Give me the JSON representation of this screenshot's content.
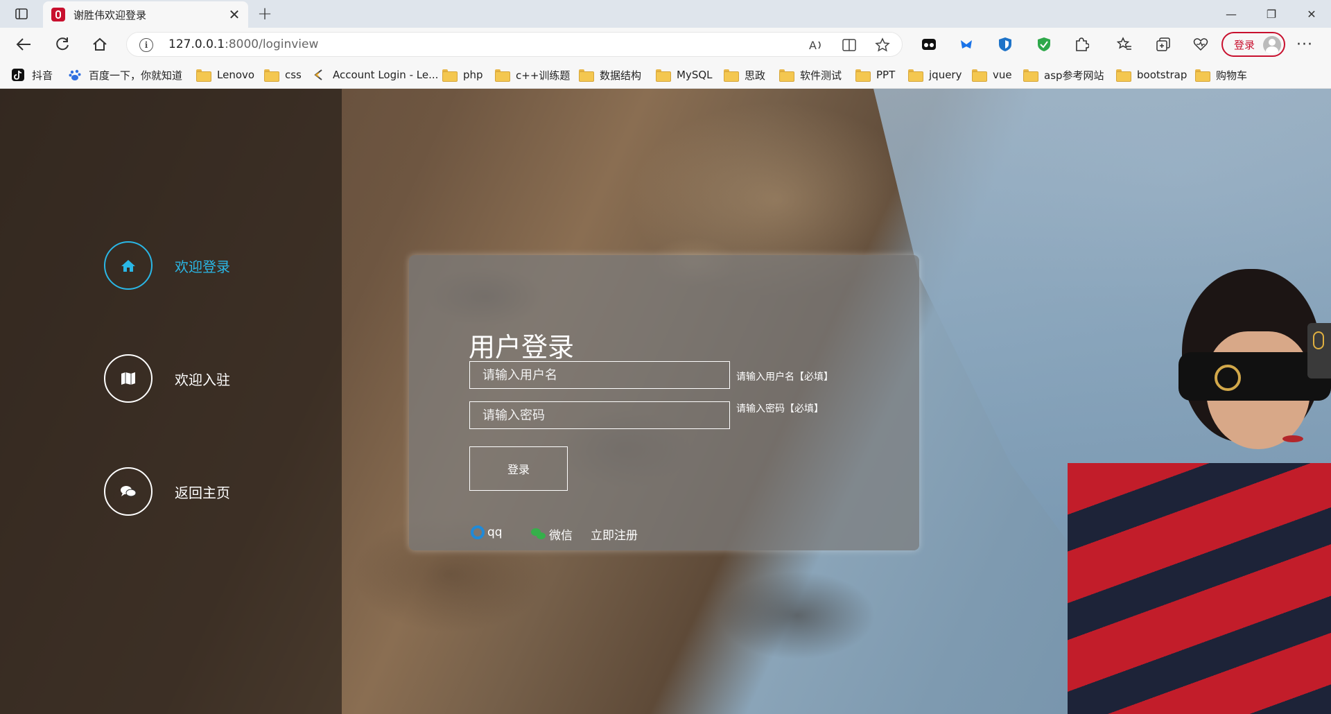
{
  "browser": {
    "tab_title": "谢胜伟欢迎登录",
    "tab_close": "✕",
    "new_tab": "+",
    "address": {
      "host": "127.0.0.1",
      "path": ":8000/loginview"
    },
    "profile_button": "登录",
    "more": "···",
    "window_controls": {
      "minimize": "—",
      "restore": "❐",
      "close": "✕"
    }
  },
  "bookmarks": [
    {
      "label": "抖音",
      "icon": "douyin-icon"
    },
    {
      "label": "百度一下，你就知道",
      "icon": "baidu-icon"
    },
    {
      "label": "Lenovo",
      "icon": "folder-icon"
    },
    {
      "label": "css",
      "icon": "folder-icon"
    },
    {
      "label": "Account Login - Le...",
      "icon": "lenovo-login-icon"
    },
    {
      "label": "php",
      "icon": "folder-icon"
    },
    {
      "label": "c++训练题",
      "icon": "folder-icon"
    },
    {
      "label": "数据结构",
      "icon": "folder-icon"
    },
    {
      "label": "MySQL",
      "icon": "folder-icon"
    },
    {
      "label": "思政",
      "icon": "folder-icon"
    },
    {
      "label": "软件测试",
      "icon": "folder-icon"
    },
    {
      "label": "PPT",
      "icon": "folder-icon"
    },
    {
      "label": "jquery",
      "icon": "folder-icon"
    },
    {
      "label": "vue",
      "icon": "folder-icon"
    },
    {
      "label": "asp参考网站",
      "icon": "folder-icon"
    },
    {
      "label": "bootstrap",
      "icon": "folder-icon"
    },
    {
      "label": "购物车",
      "icon": "folder-icon"
    }
  ],
  "sidebar": {
    "items": [
      {
        "label": "欢迎登录",
        "icon": "home-icon",
        "active": true
      },
      {
        "label": "欢迎入驻",
        "icon": "map-icon",
        "active": false
      },
      {
        "label": "返回主页",
        "icon": "chat-icon",
        "active": false
      }
    ]
  },
  "login": {
    "title": "用户登录",
    "username_placeholder": "请输入用户名",
    "username_hint": "请输入用户名【必填】",
    "password_placeholder": "请输入密码",
    "password_hint": "请输入密码【必填】",
    "submit_label": "登录",
    "qq_label": "qq",
    "wechat_label": "微信",
    "register_label": "立即注册"
  },
  "colors": {
    "accent": "#2ab7e6",
    "brand": "#c8102e",
    "card": "#7d7d7d"
  }
}
